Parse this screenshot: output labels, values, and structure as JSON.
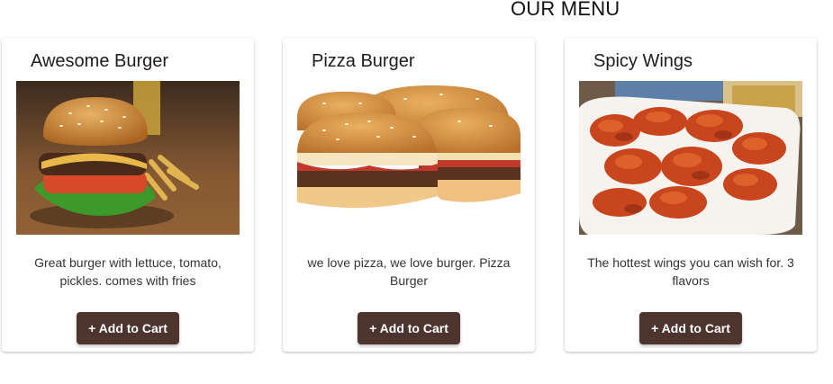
{
  "header": {
    "title": "OUR MENU"
  },
  "colors": {
    "button_bg": "#4e342e",
    "button_text": "#ffffff"
  },
  "menu": {
    "items": [
      {
        "title": "Awesome Burger",
        "image_icon": "burger-photo",
        "description": "Great burger with lettuce, tomato, pickles. comes with fries",
        "button_label": "+ Add to Cart"
      },
      {
        "title": "Pizza Burger",
        "image_icon": "pizza-burger-photo",
        "description": "we love pizza, we love burger. Pizza Burger",
        "button_label": "+ Add to Cart"
      },
      {
        "title": "Spicy Wings",
        "image_icon": "wings-photo",
        "description": "The hottest wings you can wish for. 3 flavors",
        "button_label": "+ Add to Cart"
      }
    ]
  }
}
